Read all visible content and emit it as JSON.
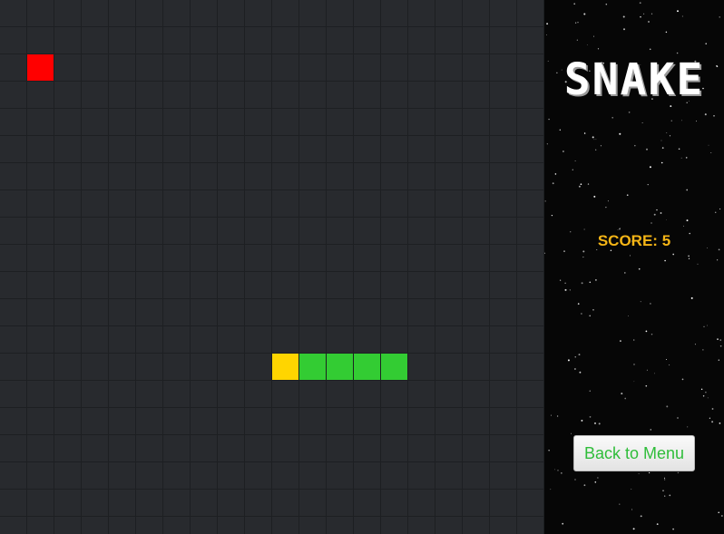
{
  "title": "SNAKE",
  "score": {
    "label": "SCORE:",
    "value": "5"
  },
  "back_button_label": "Back to Menu",
  "colors": {
    "food": "#ff0000",
    "snake_head": "#ffd500",
    "snake_body": "#33cc33",
    "score_text": "#f5b516",
    "button_text": "#2fbd3a"
  },
  "grid": {
    "columns": 20,
    "rows": 20
  },
  "food": {
    "col": 1,
    "row": 2
  },
  "snake": [
    {
      "col": 10,
      "row": 13,
      "part": "head"
    },
    {
      "col": 11,
      "row": 13,
      "part": "body"
    },
    {
      "col": 12,
      "row": 13,
      "part": "body"
    },
    {
      "col": 13,
      "row": 13,
      "part": "body"
    },
    {
      "col": 14,
      "row": 13,
      "part": "body"
    }
  ]
}
